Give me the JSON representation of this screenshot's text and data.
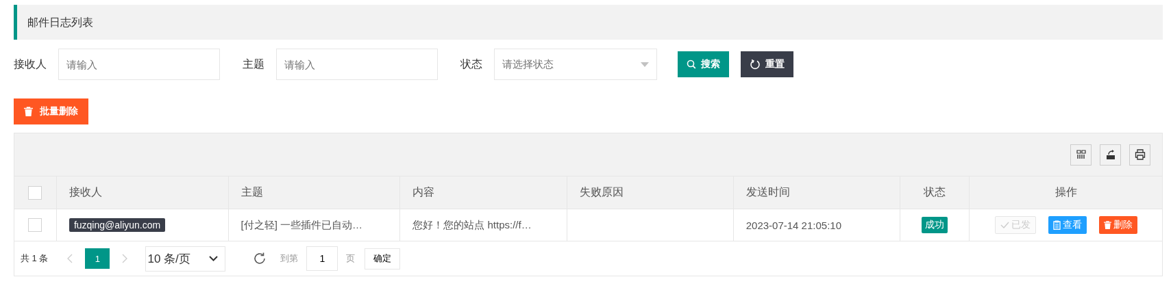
{
  "page_title": "邮件日志列表",
  "filters": [
    {
      "label": "接收人",
      "kind": "input",
      "placeholder": "请输入"
    },
    {
      "label": "主题",
      "kind": "input",
      "placeholder": "请输入"
    },
    {
      "label": "状态",
      "kind": "select",
      "placeholder": "请选择状态"
    }
  ],
  "search_button": "搜索",
  "reset_button": "重置",
  "batch_delete_button": "批量删除",
  "table": {
    "select_all_checked": false,
    "columns": [
      "接收人",
      "主题",
      "内容",
      "失败原因",
      "发送时间",
      "状态",
      "操作"
    ],
    "rows": [
      {
        "checked": false,
        "recipient": "fuzqing@aliyun.com",
        "subject": "[付之轻] 一些插件已自动…",
        "content": "您好！您的站点 https://f…",
        "sent_time": "2023-07-14 21:05:10",
        "status": "成功",
        "color": "#009688",
        "actions": [
          {
            "label": "已发",
            "kind": "sent",
            "disabled": true
          },
          {
            "label": "查看",
            "kind": "view",
            "disabled": false
          },
          {
            "label": "删除",
            "kind": "delete",
            "disabled": false
          }
        ]
      }
    ]
  },
  "pager": {
    "total": "共 1 条",
    "pages": [
      {
        "label": "1",
        "selected": true
      }
    ],
    "page_size": "10 条/页",
    "goto_label": "到第",
    "goto_value": "1",
    "page_unit": "页",
    "confirm": "确定"
  }
}
